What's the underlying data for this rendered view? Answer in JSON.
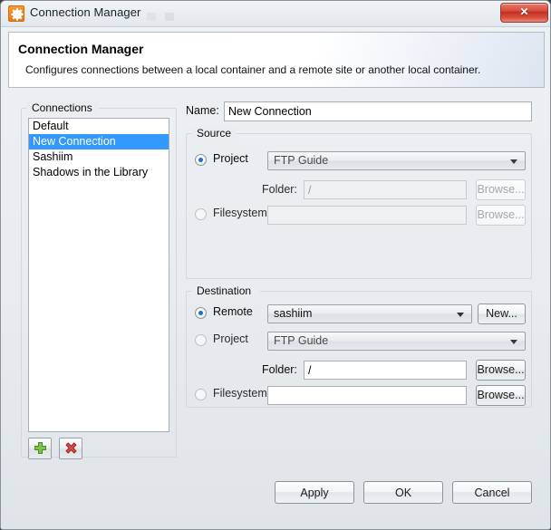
{
  "window": {
    "title": "Connection Manager",
    "icon": "gear-icon",
    "close_label": "Close"
  },
  "header": {
    "title": "Connection Manager",
    "subtitle": "Configures connections between a local container and a remote site or another local container."
  },
  "connections": {
    "group_label": "Connections",
    "items": [
      {
        "label": "Default",
        "selected": false
      },
      {
        "label": "New Connection",
        "selected": true
      },
      {
        "label": "Sashiim",
        "selected": false
      },
      {
        "label": "Shadows in the Library",
        "selected": false
      }
    ],
    "add_button": "add-icon",
    "delete_button": "delete-icon"
  },
  "name": {
    "label": "Name:",
    "value": "New Connection",
    "placeholder": ""
  },
  "source": {
    "group_label": "Source",
    "project_radio": {
      "label": "Project",
      "checked": true
    },
    "project_combo": {
      "value": "FTP Guide",
      "enabled": false
    },
    "folder_label": "Folder:",
    "folder_field": {
      "value": "/",
      "enabled": false
    },
    "folder_browse": {
      "label": "Browse...",
      "enabled": false
    },
    "filesystem_radio": {
      "label": "Filesystem",
      "checked": false
    },
    "filesystem_field": {
      "value": "",
      "enabled": false
    },
    "filesystem_browse": {
      "label": "Browse...",
      "enabled": false
    }
  },
  "destination": {
    "group_label": "Destination",
    "remote_radio": {
      "label": "Remote",
      "checked": true
    },
    "remote_combo": {
      "value": "sashiim",
      "enabled": true
    },
    "new_button": {
      "label": "New...",
      "enabled": true
    },
    "project_radio": {
      "label": "Project",
      "checked": false
    },
    "project_combo": {
      "value": "FTP Guide",
      "enabled": false
    },
    "folder_label": "Folder:",
    "folder_field": {
      "value": "/",
      "enabled": true
    },
    "folder_browse": {
      "label": "Browse...",
      "enabled": true
    },
    "filesystem_radio": {
      "label": "Filesystem",
      "checked": false
    },
    "filesystem_field": {
      "value": "",
      "enabled": true
    },
    "filesystem_browse": {
      "label": "Browse...",
      "enabled": true
    }
  },
  "footer": {
    "apply_label": "Apply",
    "ok_label": "OK",
    "cancel_label": "Cancel"
  },
  "colors": {
    "selection_blue": "#3399ff",
    "close_red": "#c22e22",
    "icon_orange": "#e87b15",
    "add_green": "#79bd3f",
    "delete_red": "#cc3a3a"
  }
}
